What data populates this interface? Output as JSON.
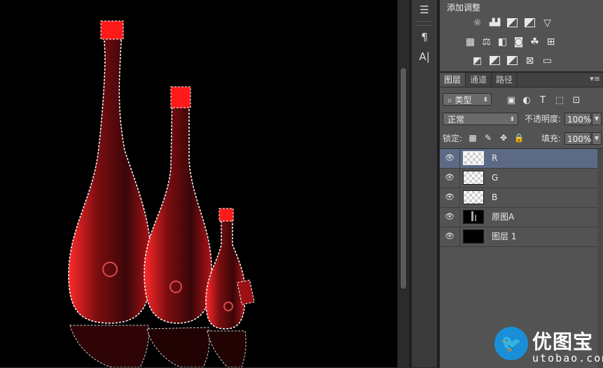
{
  "adjustments": {
    "title": "添加调整",
    "row1": [
      "brightness-icon",
      "levels-icon",
      "curves-icon",
      "exposure-icon",
      "gradient-triangle-icon"
    ],
    "row2": [
      "vibrance-icon",
      "color-balance-icon",
      "black-white-icon",
      "photo-filter-icon",
      "channel-mixer-icon",
      "color-lookup-icon"
    ],
    "row3": [
      "invert-icon",
      "posterize-icon",
      "threshold-icon",
      "selective-color-icon",
      "gradient-map-icon"
    ]
  },
  "toolstrip": {
    "items": [
      "adjust-icon",
      "paragraph-icon",
      "character-icon"
    ],
    "glyphs": [
      "☰",
      "¶",
      "A|"
    ]
  },
  "tabs": [
    {
      "label": "图层",
      "active": true
    },
    {
      "label": "通道",
      "active": false
    },
    {
      "label": "路径",
      "active": false
    }
  ],
  "filter": {
    "kind_label": "类型",
    "glyphs": [
      "▣",
      "◐",
      "T",
      "⬚",
      "⊡"
    ]
  },
  "blend": {
    "mode": "正常",
    "opacity_label": "不透明度:",
    "opacity_value": "100%"
  },
  "lock": {
    "label": "锁定:",
    "fill_label": "填充:",
    "fill_value": "100%"
  },
  "layers": [
    {
      "name": "R",
      "thumb": "checker",
      "selected": true
    },
    {
      "name": "G",
      "thumb": "checker",
      "selected": false
    },
    {
      "name": "B",
      "thumb": "checker",
      "selected": false
    },
    {
      "name": "原图A",
      "thumb": "bottle",
      "selected": false
    },
    {
      "name": "图层 1",
      "thumb": "black",
      "selected": false
    }
  ],
  "watermark": {
    "name": "优图宝",
    "url": "utobao.com"
  },
  "colors": {
    "canvas": "#000000",
    "bottle_red": "#ff1a1a",
    "panel": "#535353",
    "selection": "#5c6a86"
  }
}
